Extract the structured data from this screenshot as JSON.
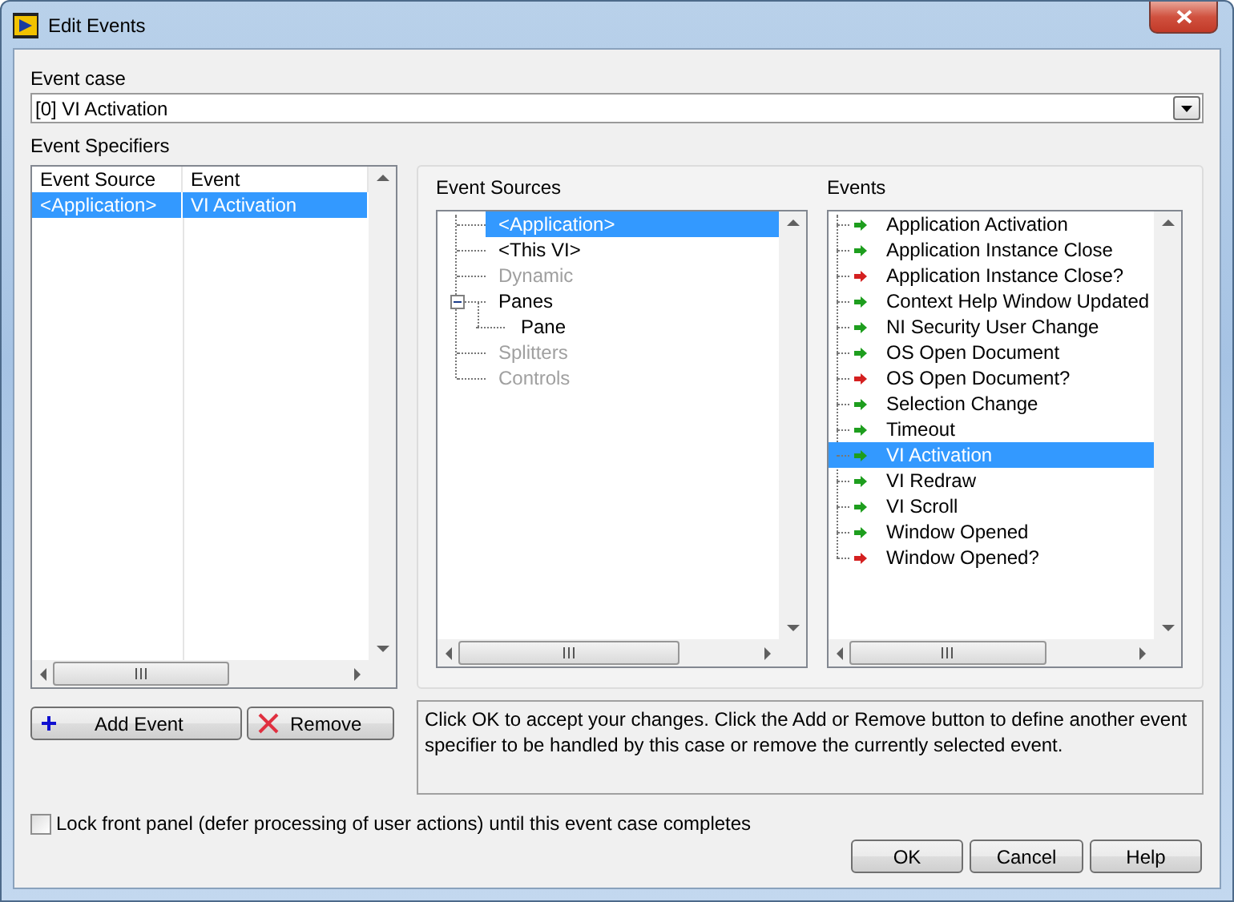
{
  "window": {
    "title": "Edit Events"
  },
  "event_case": {
    "label": "Event case",
    "value": "[0] VI Activation"
  },
  "event_specifiers": {
    "label": "Event Specifiers",
    "columns": [
      "Event Source",
      "Event"
    ],
    "rows": [
      {
        "cells": [
          "<Application>",
          "VI Activation"
        ],
        "selected": true
      }
    ]
  },
  "event_sources": {
    "label": "Event Sources",
    "items": [
      {
        "label": "<Application>",
        "selected": true,
        "disabled": false
      },
      {
        "label": "<This VI>",
        "selected": false,
        "disabled": false
      },
      {
        "label": "Dynamic",
        "selected": false,
        "disabled": true
      },
      {
        "label": "Panes",
        "selected": false,
        "disabled": false,
        "expanded": true,
        "children": [
          {
            "label": "Pane",
            "selected": false,
            "disabled": false
          }
        ]
      },
      {
        "label": "Splitters",
        "selected": false,
        "disabled": true
      },
      {
        "label": "Controls",
        "selected": false,
        "disabled": true
      }
    ]
  },
  "events": {
    "label": "Events",
    "items": [
      {
        "label": "Application Activation",
        "kind": "notify",
        "selected": false
      },
      {
        "label": "Application Instance Close",
        "kind": "notify",
        "selected": false
      },
      {
        "label": "Application Instance Close?",
        "kind": "filter",
        "selected": false
      },
      {
        "label": "Context Help Window Updated",
        "kind": "notify",
        "selected": false
      },
      {
        "label": "NI Security User Change",
        "kind": "notify",
        "selected": false
      },
      {
        "label": "OS Open Document",
        "kind": "notify",
        "selected": false
      },
      {
        "label": "OS Open Document?",
        "kind": "filter",
        "selected": false
      },
      {
        "label": "Selection Change",
        "kind": "notify",
        "selected": false
      },
      {
        "label": "Timeout",
        "kind": "notify",
        "selected": false
      },
      {
        "label": "VI Activation",
        "kind": "notify",
        "selected": true
      },
      {
        "label": "VI Redraw",
        "kind": "notify",
        "selected": false
      },
      {
        "label": "VI Scroll",
        "kind": "notify",
        "selected": false
      },
      {
        "label": "Window Opened",
        "kind": "notify",
        "selected": false
      },
      {
        "label": "Window Opened?",
        "kind": "filter",
        "selected": false
      }
    ]
  },
  "specifier_buttons": [
    {
      "label": "Add Event",
      "kind": "add"
    },
    {
      "label": "Remove",
      "kind": "remove"
    }
  ],
  "description": "Click OK to accept your changes.  Click the Add or Remove button to define another event specifier to be handled by this case or remove the currently selected event.",
  "lock_option": {
    "label": "Lock front panel (defer processing of user actions) until this event case completes",
    "checked": false
  },
  "buttons": [
    "OK",
    "Cancel",
    "Help"
  ]
}
